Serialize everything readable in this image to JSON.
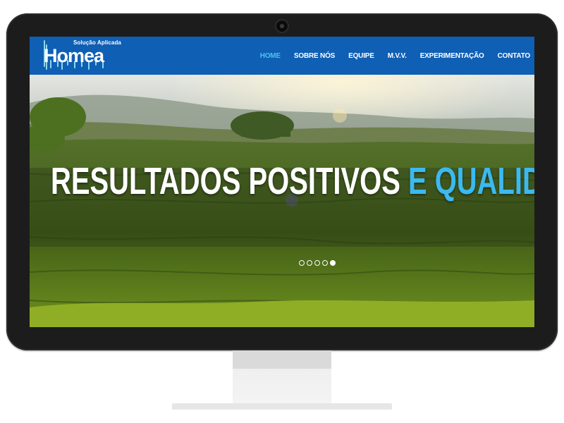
{
  "logo": {
    "sub": "Solução Aplicada",
    "name": "Homea"
  },
  "nav": {
    "items": [
      {
        "label": "HOME",
        "active": true
      },
      {
        "label": "SOBRE NÓS",
        "active": false
      },
      {
        "label": "EQUIPE",
        "active": false
      },
      {
        "label": "M.V.V.",
        "active": false
      },
      {
        "label": "EXPERIMENTAÇÃO",
        "active": false
      },
      {
        "label": "CONTATO",
        "active": false
      }
    ]
  },
  "hero": {
    "headline_white": "RESULTADOS POSITIVOS",
    "headline_blue": " E QUALIDA",
    "slides": 5,
    "active_slide": 5
  },
  "colors": {
    "navbar": "#0f5fb4",
    "accent": "#3cb9ef",
    "frame": "#1c1c1c"
  }
}
